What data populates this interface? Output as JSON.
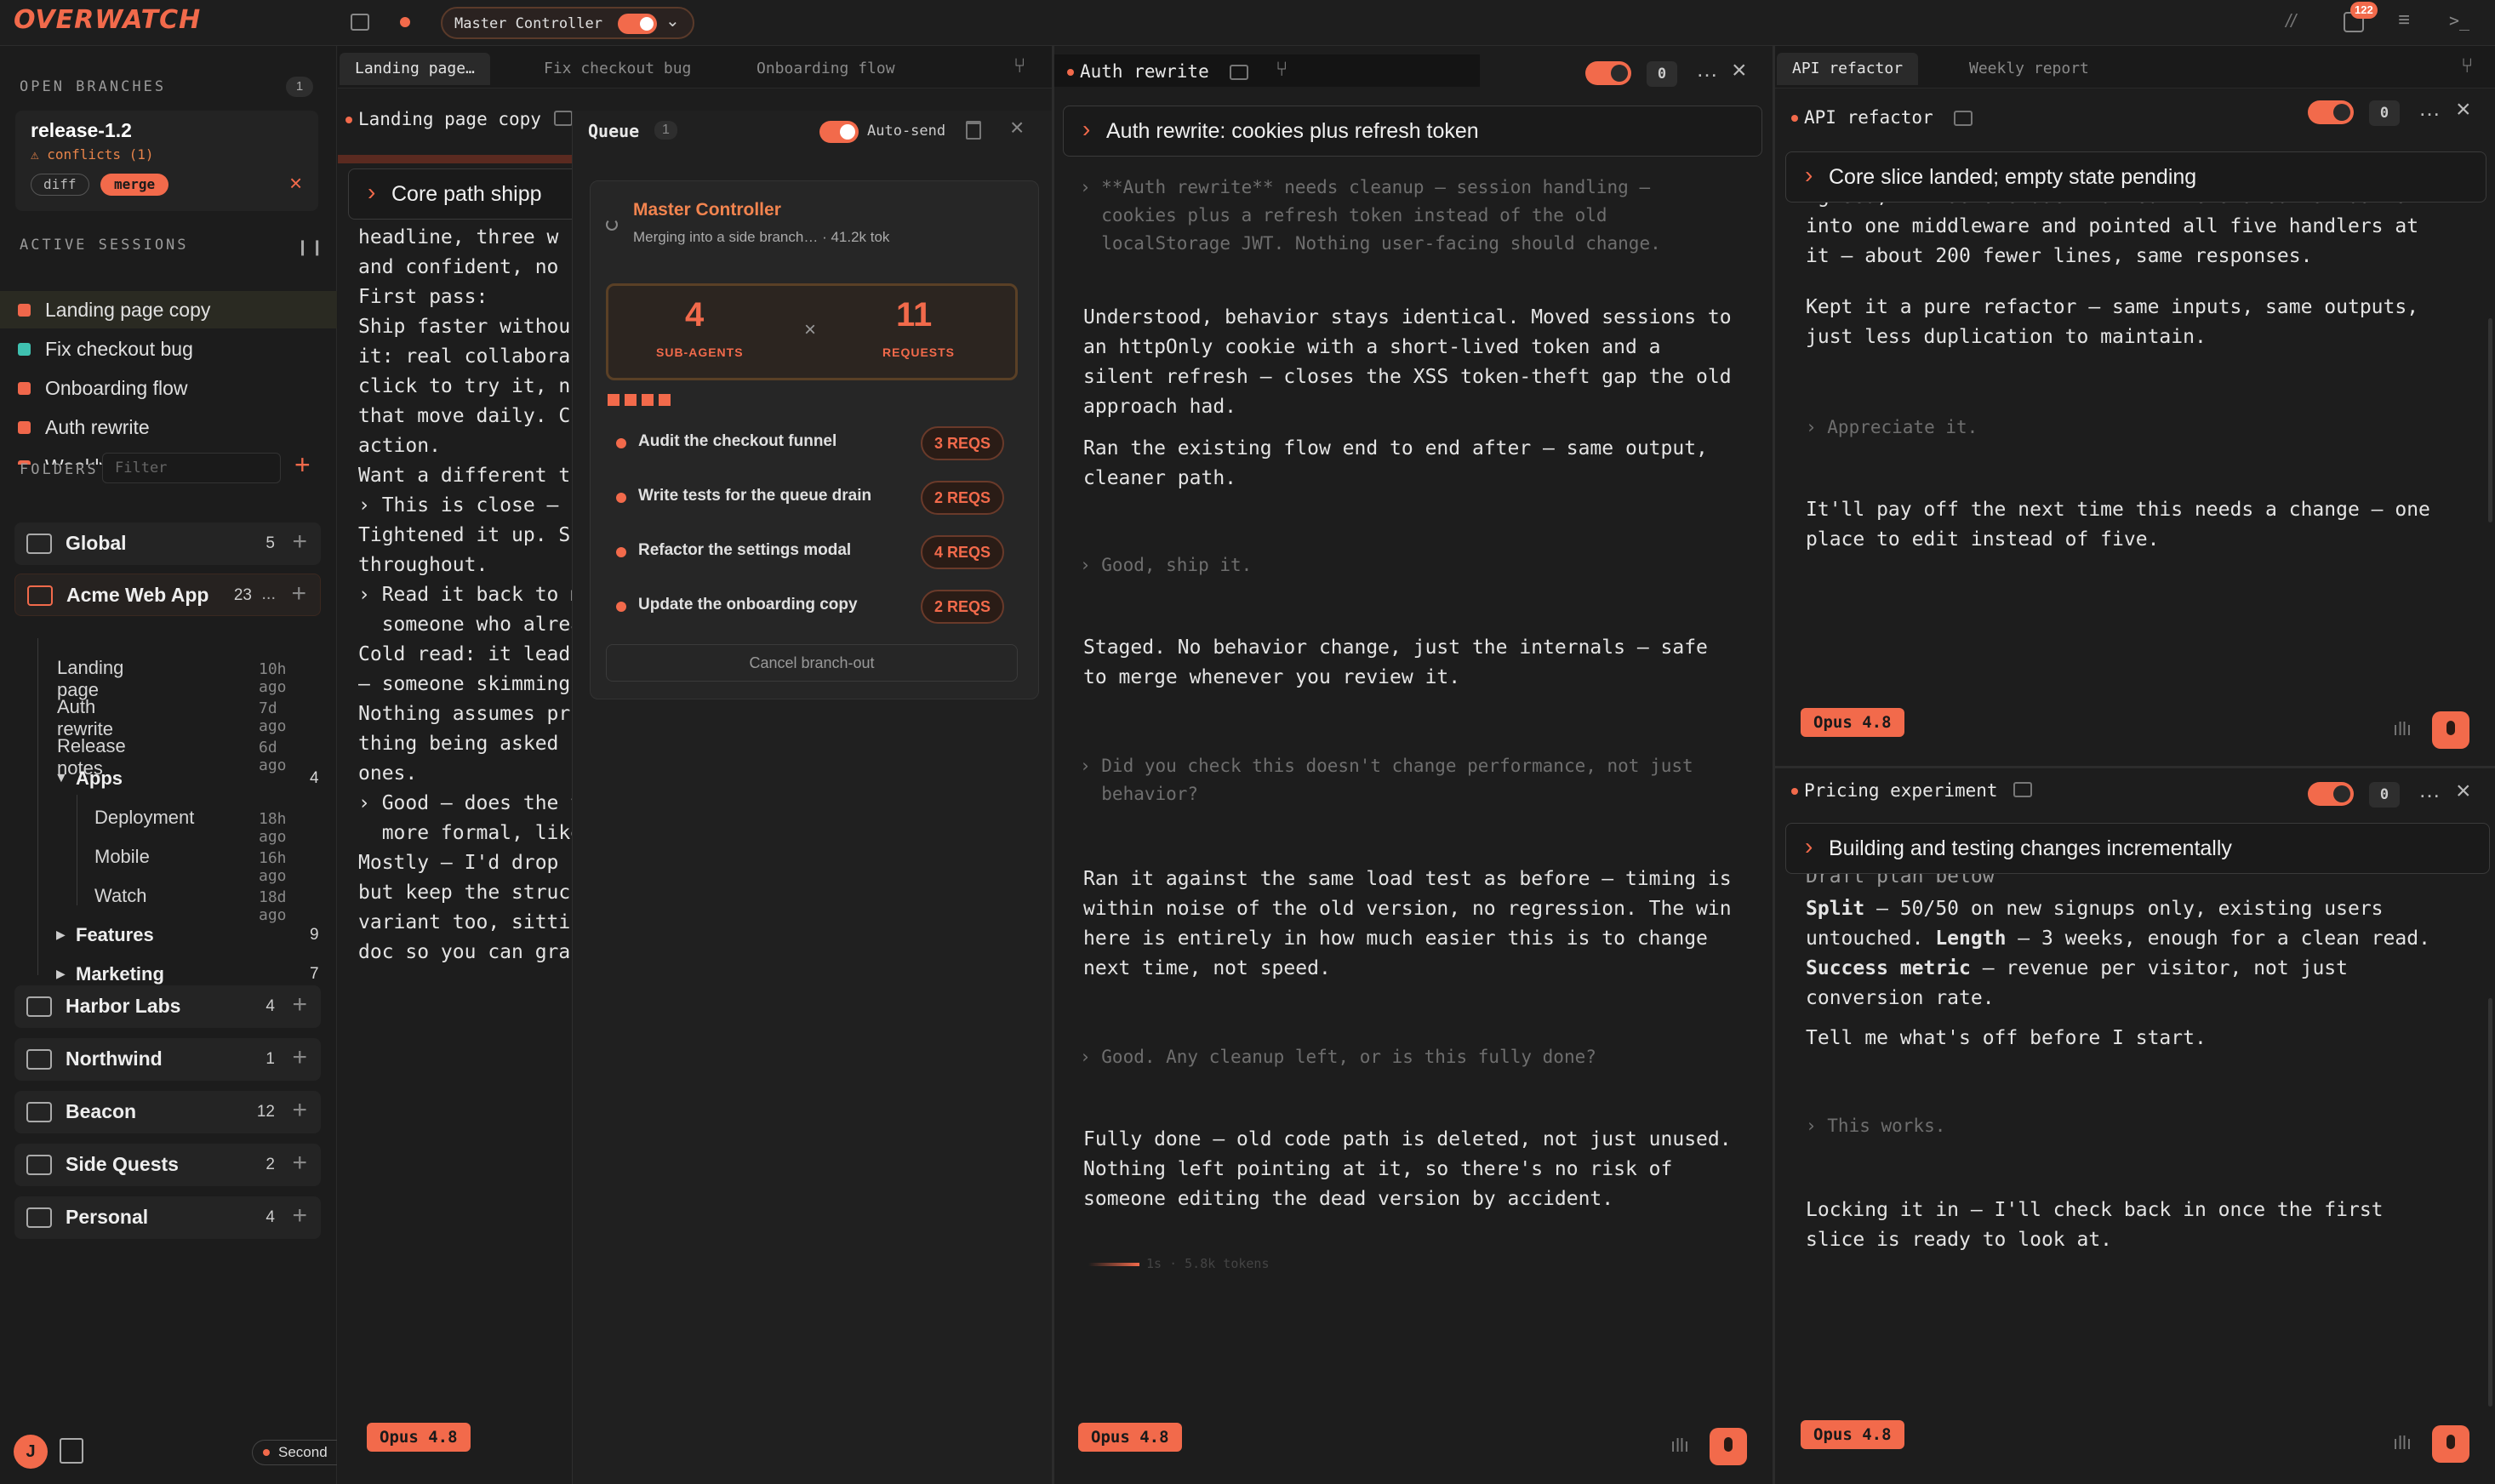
{
  "app": {
    "logo": "OVERWATCH",
    "controller": "Master Controller"
  },
  "topbar": {
    "badge": "122"
  },
  "sidebar": {
    "open_branches_title": "OPEN BRANCHES",
    "open_branches_count": "1",
    "branch": {
      "name": "release-1.2",
      "conflicts": "⚠ conflicts (1)",
      "diff": "diff",
      "merge": "merge"
    },
    "active_sessions_title": "ACTIVE SESSIONS",
    "sessions": [
      {
        "label": "Landing page copy",
        "color": "#f0674b"
      },
      {
        "label": "Fix checkout bug",
        "color": "#3fc1b0"
      },
      {
        "label": "Onboarding flow",
        "color": "#f0674b"
      },
      {
        "label": "Auth rewrite",
        "color": "#f0674b"
      },
      {
        "label": "Weekly report",
        "color": "#f0674b"
      }
    ],
    "folders_title": "FOLDERS",
    "filter_placeholder": "Filter",
    "folders": [
      {
        "label": "Global",
        "count": "5"
      },
      {
        "label": "Acme Web App",
        "count": "23"
      },
      {
        "label": "Harbor Labs",
        "count": "4"
      },
      {
        "label": "Northwind",
        "count": "1"
      },
      {
        "label": "Beacon",
        "count": "12"
      },
      {
        "label": "Side Quests",
        "count": "2"
      },
      {
        "label": "Personal",
        "count": "4"
      }
    ],
    "acme_more": "...",
    "acme_items": [
      {
        "label": "Landing page",
        "age": "10h ago"
      },
      {
        "label": "Auth rewrite",
        "age": "7d ago"
      },
      {
        "label": "Release notes",
        "age": "6d ago"
      }
    ],
    "apps": {
      "label": "Apps",
      "count": "4",
      "items": [
        {
          "label": "Deployment",
          "age": "18h ago"
        },
        {
          "label": "Mobile",
          "age": "16h ago"
        },
        {
          "label": "Watch",
          "age": "18d ago"
        }
      ]
    },
    "features": {
      "label": "Features",
      "count": "9"
    },
    "marketing": {
      "label": "Marketing",
      "count": "7"
    },
    "avatar": "J",
    "second": "Second"
  },
  "pane1": {
    "tabs": [
      "Landing page…",
      "Fix checkout bug",
      "Onboarding flow"
    ],
    "title": "Landing page copy",
    "banner": "Core path shipp",
    "lines": [
      "headline, three w",
      "and confident, no",
      "",
      "First pass:",
      "",
      "Ship faster withou",
      "it: real collabora",
      "click to try it, n",
      "that move daily. C",
      "action.",
      "",
      "Want a different t",
      "",
      "",
      "› This is close — s",
      "",
      "",
      "Tightened it up. S",
      "throughout.",
      "",
      "",
      "› Read it back to m",
      "  someone who alrea",
      "",
      "",
      "Cold read: it lead",
      "— someone skimming",
      "Nothing assumes pr",
      "thing being asked",
      "ones.",
      "",
      "",
      "› Good — does the t",
      "  more formal, like",
      "",
      "",
      "Mostly — I'd drop",
      "but keep the struc",
      "variant too, sitti",
      "doc so you can gra"
    ],
    "model": "Opus 4.8"
  },
  "queue": {
    "title": "Queue",
    "count": "1",
    "autosend": "Auto-send",
    "controller_title": "Master Controller",
    "controller_sub": "Merging into a side branch… · 41.2k tok",
    "subagents_n": "4",
    "subagents_label": "SUB-AGENTS",
    "requests_n": "11",
    "requests_label": "REQUESTS",
    "times": "×",
    "items": [
      {
        "label": "Audit the checkout funnel",
        "reqs": "3 REQS"
      },
      {
        "label": "Write tests for the queue drain",
        "reqs": "2 REQS"
      },
      {
        "label": "Refactor the settings modal",
        "reqs": "4 REQS"
      },
      {
        "label": "Update the onboarding copy",
        "reqs": "2 REQS"
      }
    ],
    "cancel": "Cancel branch-out"
  },
  "pane2": {
    "title": "Auth rewrite",
    "zero": "0",
    "banner": "Auth rewrite: cookies plus refresh token",
    "u1": [
      "› **Auth rewrite** needs cleanup — session handling —",
      "  cookies plus a refresh token instead of the old",
      "  localStorage JWT. Nothing user-facing should change."
    ],
    "a1": [
      "Understood, behavior stays identical. Moved sessions to",
      "an httpOnly cookie with a short-lived token and a",
      "silent refresh — closes the XSS token-theft gap the old",
      "approach had."
    ],
    "a1b": [
      "Ran the existing flow end to end after — same output,",
      "cleaner path."
    ],
    "u2": [
      "› Good, ship it."
    ],
    "a2": [
      "Staged. No behavior change, just the internals — safe",
      "to merge whenever you review it."
    ],
    "u3": [
      "› Did you check this doesn't change performance, not just",
      "  behavior?"
    ],
    "a3": [
      "Ran it against the same load test as before — timing is",
      "within noise of the old version, no regression. The win",
      "here is entirely in how much easier this is to change",
      "next time, not speed."
    ],
    "u4": [
      "› Good. Any cleanup left, or is this fully done?"
    ],
    "a4": [
      "Fully done — old code path is deleted, not just unused.",
      "Nothing left pointing at it, so there's no risk of",
      "someone editing the dead version by accident."
    ],
    "progress": "1s · 5.8k tokens",
    "model": "Opus 4.8"
  },
  "pane3": {
    "tabs": [
      "API refactor",
      "Weekly report"
    ],
    "title": "API refactor",
    "zero": "0",
    "banner": "Core slice landed; empty state pending",
    "a1": [
      "Agreed, it was overdue. Pulled the shared validation",
      "into one middleware and pointed all five handlers at",
      "it — about 200 fewer lines, same responses."
    ],
    "a1b": [
      "Kept it a pure refactor — same inputs, same outputs,",
      "just less duplication to maintain."
    ],
    "u1": [
      "› Appreciate it."
    ],
    "a2": [
      "It'll pay off the next time this needs a change — one",
      "place to edit instead of five."
    ],
    "model": "Opus 4.8"
  },
  "pane4": {
    "title": "Pricing experiment",
    "zero": "0",
    "banner": "Building and testing changes incrementally",
    "partial": "Draft plan below",
    "split_k": "Split",
    "split_v": " — 50/50 on new signups only, existing users",
    "split_v2": "untouched. ",
    "length_k": "Length",
    "length_v": " — 3 weeks, enough for a clean read.",
    "metric_k": "Success metric",
    "metric_v": " — revenue per visitor, not just",
    "metric_v2": "conversion rate.",
    "tell": "Tell me what's off before I start.",
    "u1": "› This works.",
    "a2": [
      "Locking it in — I'll check back in once the first",
      "slice is ready to look at."
    ],
    "model": "Opus 4.8"
  }
}
